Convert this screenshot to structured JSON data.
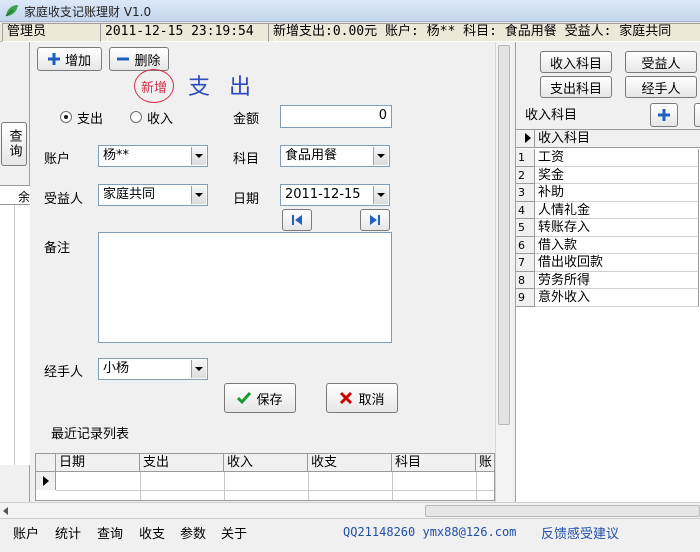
{
  "window": {
    "title": "家庭收支记账理财 V1.0"
  },
  "status": {
    "user": "管理员",
    "datetime": "2011-12-15 23:19:54",
    "message": "新增支出:0.00元 账户: 杨** 科目: 食品用餐 受益人: 家庭共同"
  },
  "left_strip": {
    "query_label": "查询",
    "col_header": "余"
  },
  "toolbar": {
    "add_label": "增加",
    "delete_label": "删除"
  },
  "form": {
    "mode_badge": "新增",
    "mode_title": "支 出",
    "type_options": {
      "expense": "支出",
      "income": "收入"
    },
    "amount_label": "金额",
    "amount_value": "0",
    "account_label": "账户",
    "account_value": "杨**",
    "category_label": "科目",
    "category_value": "食品用餐",
    "beneficiary_label": "受益人",
    "beneficiary_value": "家庭共同",
    "date_label": "日期",
    "date_value": "2011-12-15",
    "note_label": "备注",
    "handler_label": "经手人",
    "handler_value": "小杨",
    "save_label": "保存",
    "cancel_label": "取消"
  },
  "recent": {
    "title": "最近记录列表",
    "columns": [
      "日期",
      "支出",
      "收入",
      "收支",
      "科目",
      "账"
    ]
  },
  "right_panel": {
    "buttons": {
      "income_category": "收入科目",
      "beneficiary": "受益人",
      "expense_category": "支出科目",
      "handler": "经手人"
    },
    "list_title": "收入科目",
    "grid_header": "收入科目",
    "rows": [
      {
        "no": "1",
        "name": "工资"
      },
      {
        "no": "2",
        "name": "奖金"
      },
      {
        "no": "3",
        "name": "补助"
      },
      {
        "no": "4",
        "name": "人情礼金"
      },
      {
        "no": "5",
        "name": "转账存入"
      },
      {
        "no": "6",
        "name": "借入款"
      },
      {
        "no": "7",
        "name": "借出收回款"
      },
      {
        "no": "8",
        "name": "劳务所得"
      },
      {
        "no": "9",
        "name": "意外收入"
      }
    ]
  },
  "menubar": {
    "items": [
      "账户",
      "统计",
      "查询",
      "收支",
      "参数",
      "关于"
    ],
    "contact": "QQ21148260 ymx88@126.com",
    "feedback": "反馈感受建议"
  },
  "colors": {
    "accent_blue": "#1f5fbf",
    "title_blue": "#2f4bbf",
    "badge_red": "#d0304a",
    "cancel_red": "#cc0000",
    "save_green": "#1c9a2c"
  }
}
